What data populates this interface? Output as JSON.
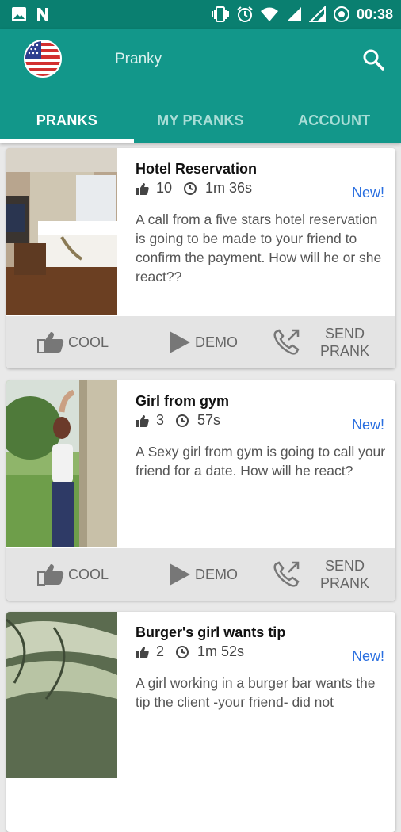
{
  "status_bar": {
    "time": "00:38"
  },
  "app": {
    "title": "Pranky"
  },
  "tabs": [
    {
      "label": "PRANKS",
      "active": true
    },
    {
      "label": "MY PRANKS",
      "active": false
    },
    {
      "label": "ACCOUNT",
      "active": false
    }
  ],
  "pranks": [
    {
      "title": "Hotel Reservation",
      "likes": "10",
      "duration": "1m 36s",
      "badge": "New!",
      "description": "A call from a five stars hotel reservation is going to be made to your friend to confirm the payment. How will he or she react??"
    },
    {
      "title": "Girl from gym",
      "likes": "3",
      "duration": "57s",
      "badge": "New!",
      "description": "A Sexy girl from gym is going to call your friend for a date. How will he react?"
    },
    {
      "title": "Burger's girl wants tip",
      "likes": "2",
      "duration": "1m 52s",
      "badge": "New!",
      "description": "A girl working in a burger bar wants the tip the client -your friend- did not"
    }
  ],
  "actions": {
    "cool_label": "COOL",
    "demo_label": "DEMO",
    "send_line1": "SEND",
    "send_line2": "PRANK"
  },
  "colors": {
    "primary": "#12978a",
    "primary_dark": "#0a7f70",
    "accent_link": "#2a6fe0"
  }
}
